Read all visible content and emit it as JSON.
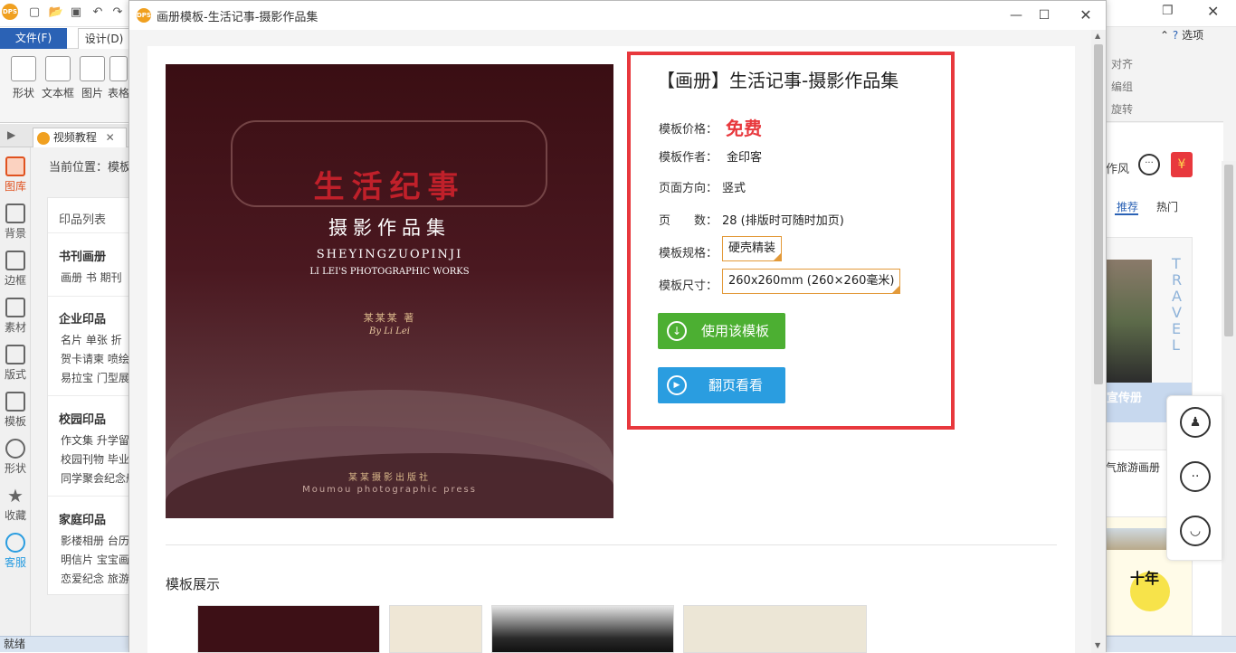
{
  "app": {
    "ribbon_tabs": {
      "file": "文件(F)",
      "design": "设计(D)"
    },
    "ribbon_buttons": [
      "形状",
      "文本框",
      "图片",
      "表格"
    ],
    "doc_tab": "视频教程",
    "breadcrumb": "当前位置：模板",
    "sidebar": [
      "图库",
      "背景",
      "边框",
      "素材",
      "版式",
      "模板",
      "形状",
      "收藏",
      "客服"
    ],
    "status": "就绪",
    "right_strip": {
      "options": "选项",
      "align": "对齐",
      "group": "编组",
      "rotate": "旋转",
      "tab_recommend": "推荐",
      "tab_hot": "热门",
      "style": "作风",
      "travel_text": "TRAVEL",
      "promo": "宣传册",
      "travel_album": "气旅游画册",
      "ten_years": "十年"
    }
  },
  "categories": {
    "title": "印品列表",
    "groups": [
      {
        "heading": "书刊画册",
        "lines": [
          "画册  书  期刊"
        ]
      },
      {
        "heading": "企业印品",
        "lines": [
          "名片  单张  折",
          "贺卡请柬  喷绘",
          "易拉宝  门型展"
        ]
      },
      {
        "heading": "校园印品",
        "lines": [
          "作文集  升学留",
          "校园刊物  毕业",
          "同学聚会纪念册"
        ]
      },
      {
        "heading": "家庭印品",
        "lines": [
          "影楼相册  台历",
          "明信片  宝宝画",
          "恋爱纪念  旅游"
        ]
      }
    ]
  },
  "dialog": {
    "title": "画册模板-生活记事-摄影作品集",
    "cover": {
      "calligraphy": "生活纪事",
      "title": "摄影作品集",
      "pinyin": "SHEYINGZUOPINJI",
      "english": "LI LEI'S PHOTOGRAPHIC WORKS",
      "author": "某某某   著",
      "byline": "By Li Lei",
      "publisher": "某某摄影出版社",
      "publisher_en": "Moumou photographic press"
    },
    "info": {
      "title": "【画册】生活记事-摄影作品集",
      "price_label": "模板价格：",
      "price": "免费",
      "author_label": "模板作者：",
      "author": "金印客",
      "orientation_label": "页面方向：",
      "orientation": "竖式",
      "pages_label": "页　　数：",
      "pages": "28 (排版时可随时加页)",
      "spec_label": "模板规格：",
      "spec": "硬壳精装",
      "size_label": "模板尺寸：",
      "size": "260x260mm (260×260毫米)",
      "use_button": "使用该模板",
      "flip_button": "翻页看看"
    },
    "showcase_title": "模板展示"
  },
  "colors": {
    "accent_red": "#e8383d",
    "use_green": "#4caf32",
    "flip_blue": "#2a9de0",
    "file_tab_blue": "#2b62b5"
  }
}
